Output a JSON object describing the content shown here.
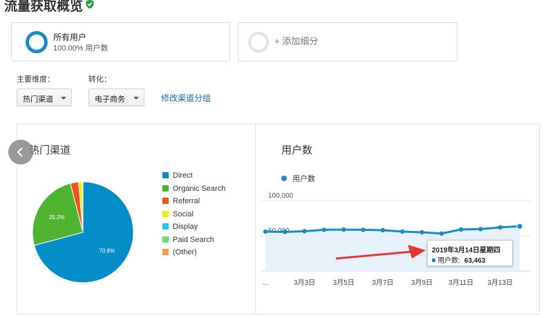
{
  "page": {
    "title": "流量获取概览"
  },
  "colors": {
    "accent": "#1a8bc6",
    "link": "#1a66b5",
    "arrow": "#e53935"
  },
  "segments": [
    {
      "name": "所有用户",
      "subtitle": "100.00% 用户数"
    },
    {
      "name": "+ 添加细分"
    }
  ],
  "controls": {
    "dimension_label": "主要维度：",
    "dimension_value": "热门渠道",
    "conversion_label": "转化：",
    "conversion_value": "电子商务",
    "edit_channel_link": "修改渠道分组"
  },
  "pie_panel": {
    "title": "热门渠道"
  },
  "line_panel": {
    "title": "用户数"
  },
  "tooltip": {
    "date": "2019年3月14日星期四",
    "metric": "用户数:",
    "value": "63,463"
  },
  "chart_data": [
    {
      "type": "pie",
      "title": "热门渠道",
      "labels": [
        "Direct",
        "Organic Search",
        "Referral",
        "Social",
        "Display",
        "Paid Search",
        "(Other)"
      ],
      "values": [
        70.8,
        25.2,
        2.6,
        1.2,
        0.1,
        0.05,
        0.05
      ],
      "value_labels": [
        "70.8%",
        "25.2%"
      ],
      "colors": [
        "#058dc7",
        "#50b432",
        "#ed561b",
        "#edef00",
        "#24cbe5",
        "#64e572",
        "#ff9655"
      ],
      "legend_position": "right"
    },
    {
      "type": "area",
      "title": "用户数",
      "series": [
        {
          "name": "用户数",
          "x": [
            "2019-03-01",
            "2019-03-02",
            "2019-03-03",
            "2019-03-04",
            "2019-03-05",
            "2019-03-06",
            "2019-03-07",
            "2019-03-08",
            "2019-03-09",
            "2019-03-10",
            "2019-03-11",
            "2019-03-12",
            "2019-03-13",
            "2019-03-14"
          ],
          "values": [
            56000,
            55500,
            56500,
            58500,
            58800,
            58500,
            58000,
            56000,
            55000,
            53200,
            59000,
            59500,
            62000,
            63463
          ]
        }
      ],
      "x_tick_labels": [
        "...",
        "3月3日",
        "3月5日",
        "3月7日",
        "3月9日",
        "3月11日",
        "3月13日"
      ],
      "y_tick_labels": [
        "100,000",
        "50,000"
      ],
      "y_ticks": [
        100000,
        50000
      ],
      "ylim": [
        0,
        110000
      ],
      "grid": true,
      "legend_position": "top-left",
      "color": "#1a8bc6"
    }
  ]
}
